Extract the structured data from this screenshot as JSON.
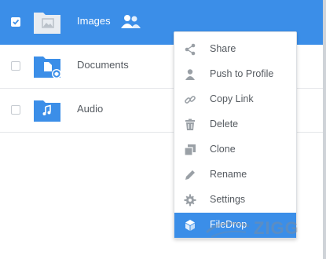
{
  "rows": [
    {
      "label": "Images",
      "checked": true,
      "icon": "image-folder-icon"
    },
    {
      "label": "Documents",
      "checked": false,
      "icon": "documents-folder-icon"
    },
    {
      "label": "Audio",
      "checked": false,
      "icon": "audio-folder-icon"
    }
  ],
  "menu": {
    "items": [
      {
        "label": "Share",
        "icon": "share-icon"
      },
      {
        "label": "Push to Profile",
        "icon": "person-icon"
      },
      {
        "label": "Copy Link",
        "icon": "link-icon"
      },
      {
        "label": "Delete",
        "icon": "trash-icon"
      },
      {
        "label": "Clone",
        "icon": "clone-icon"
      },
      {
        "label": "Rename",
        "icon": "pencil-icon"
      },
      {
        "label": "Settings",
        "icon": "gear-icon"
      },
      {
        "label": "FileDrop",
        "icon": "filedrop-icon",
        "active": true
      }
    ]
  },
  "watermark": {
    "text": "ZIGG"
  },
  "colors": {
    "accent": "#3b8ee8",
    "text": "#555a60",
    "icon": "#9aa0a6"
  }
}
